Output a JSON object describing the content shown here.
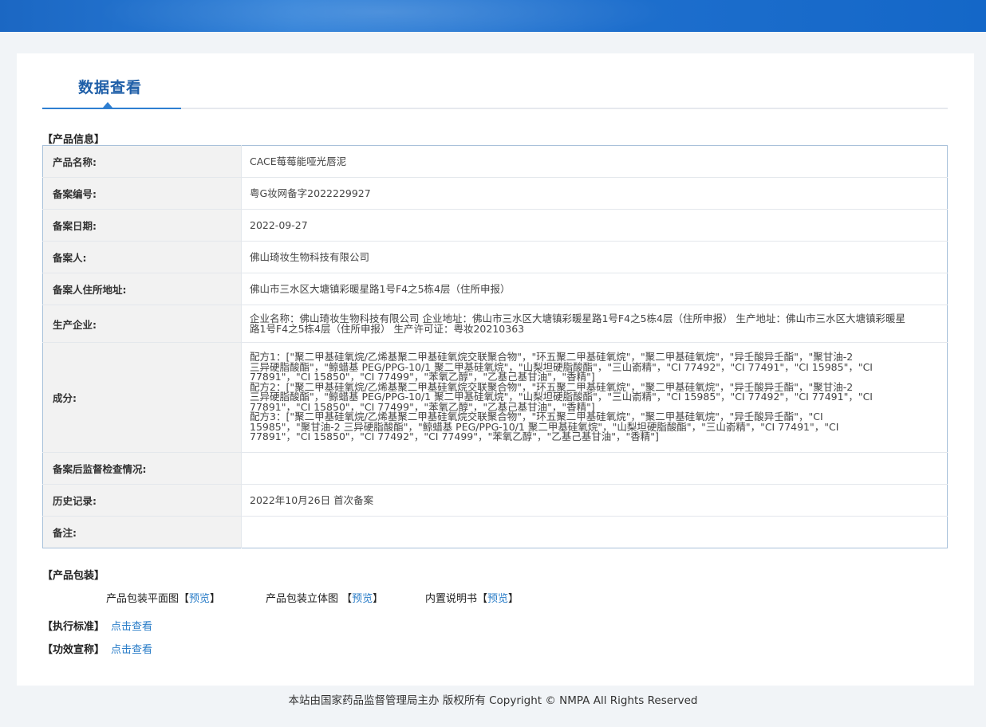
{
  "page": {
    "title": "数据查看",
    "footer": "本站由国家药品监督管理局主办 版权所有 Copyright © NMPA All Rights Reserved"
  },
  "product_info": {
    "section_label": "【产品信息】",
    "rows": [
      {
        "key": "产品名称:",
        "value": "CACE莓莓能哑光唇泥"
      },
      {
        "key": "备案编号:",
        "value": "粤G妆网备字2022229927"
      },
      {
        "key": "备案日期:",
        "value": "2022-09-27"
      },
      {
        "key": "备案人:",
        "value": "佛山琦妆生物科技有限公司"
      },
      {
        "key": "备案人住所地址:",
        "value": "佛山市三水区大塘镇彩暖星路1号F4之5栋4层（住所申报）"
      },
      {
        "key": "生产企业:",
        "value": "企业名称：佛山琦妆生物科技有限公司 企业地址：佛山市三水区大塘镇彩暖星路1号F4之5栋4层（住所申报） 生产地址：佛山市三水区大塘镇彩暖星路1号F4之5栋4层（住所申报） 生产许可证：粤妆20210363"
      },
      {
        "key": "成分:",
        "value": ""
      },
      {
        "key": "备案后监督检查情况:",
        "value": ""
      },
      {
        "key": "历史记录:",
        "value": "2022年10月26日 首次备案"
      },
      {
        "key": "备注:",
        "value": ""
      }
    ],
    "ingredients": [
      "配方1：[\"聚二甲基硅氧烷/乙烯基聚二甲基硅氧烷交联聚合物\"，\"环五聚二甲基硅氧烷\"，\"聚二甲基硅氧烷\"，\"异壬酸异壬酯\"，\"聚甘油-2",
      "三异硬脂酸酯\"，\"鲸蜡基 PEG/PPG-10/1 聚二甲基硅氧烷\"，\"山梨坦硬脂酸酯\"，\"三山嵛精\"，\"CI 77492\"，\"CI 77491\"，\"CI 15985\"，\"CI",
      "77891\"，\"CI 15850\"，\"CI 77499\"，\"苯氧乙醇\"，\"乙基己基甘油\"，\"香精\"]",
      "配方2：[\"聚二甲基硅氧烷/乙烯基聚二甲基硅氧烷交联聚合物\"，\"环五聚二甲基硅氧烷\"，\"聚二甲基硅氧烷\"，\"异壬酸异壬酯\"，\"聚甘油-2",
      "三异硬脂酸酯\"，\"鲸蜡基 PEG/PPG-10/1 聚二甲基硅氧烷\"，\"山梨坦硬脂酸酯\"，\"三山嵛精\"，\"CI 15985\"，\"CI 77492\"，\"CI 77491\"，\"CI",
      "77891\"，\"CI 15850\"，\"CI 77499\"，\"苯氧乙醇\"，\"乙基己基甘油\"，\"香精\"]",
      "配方3：[\"聚二甲基硅氧烷/乙烯基聚二甲基硅氧烷交联聚合物\"，\"环五聚二甲基硅氧烷\"，\"聚二甲基硅氧烷\"，\"异壬酸异壬酯\"，\"CI",
      "15985\"，\"聚甘油-2 三异硬脂酸酯\"，\"鲸蜡基 PEG/PPG-10/1 聚二甲基硅氧烷\"，\"山梨坦硬脂酸酯\"，\"三山嵛精\"，\"CI 77491\"，\"CI",
      "77891\"，\"CI 15850\"，\"CI 77492\"，\"CI 77499\"，\"苯氧乙醇\"，\"乙基己基甘油\"，\"香精\"]"
    ]
  },
  "packaging": {
    "section_label": "【产品包装】",
    "items": [
      {
        "label": "产品包装平面图【",
        "link": "预览",
        "suffix": "】"
      },
      {
        "label": "产品包装立体图 【",
        "link": "预览",
        "suffix": "】"
      },
      {
        "label": "内置说明书【",
        "link": "预览",
        "suffix": "】"
      }
    ]
  },
  "standards": {
    "label": "【执行标准】",
    "link": "点击查看"
  },
  "efficacy": {
    "label": "【功效宣称】",
    "link": "点击查看"
  }
}
